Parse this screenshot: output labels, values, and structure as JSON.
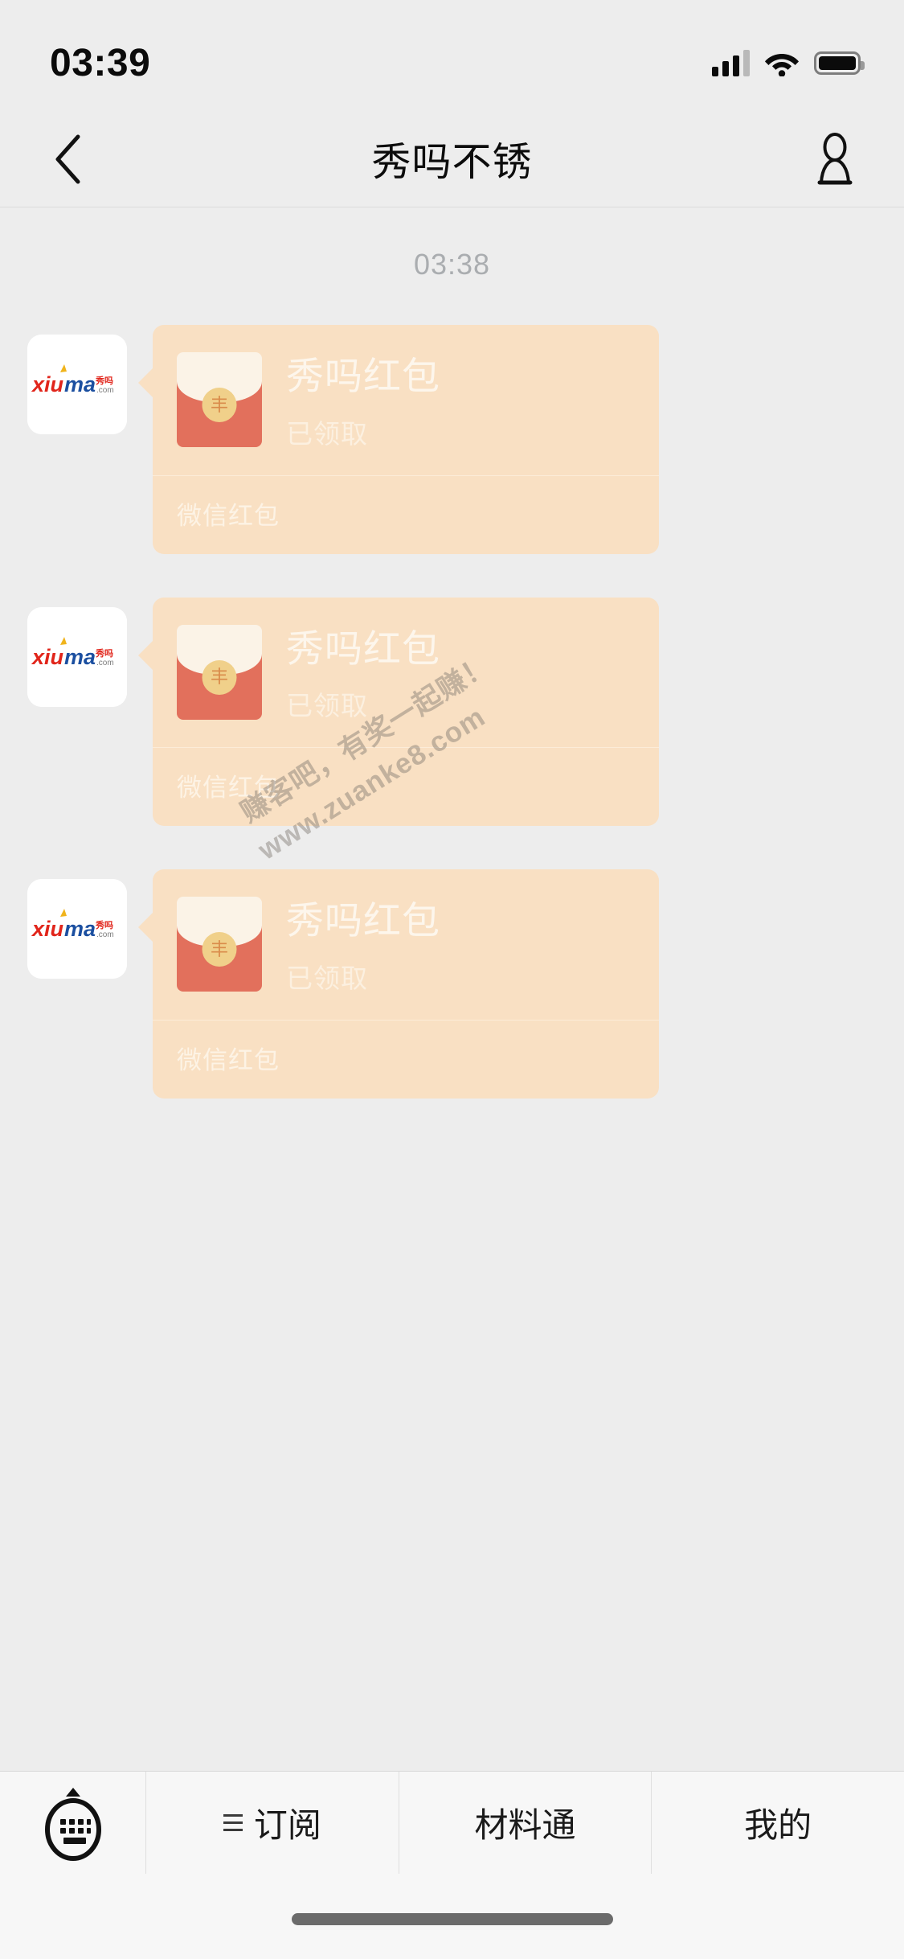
{
  "status_bar": {
    "time": "03:39",
    "signal_icon": "cellular-signal-icon",
    "wifi_icon": "wifi-icon",
    "battery_icon": "battery-icon"
  },
  "nav_bar": {
    "back_icon": "chevron-left-icon",
    "title": "秀吗不锈",
    "contact_icon": "person-icon"
  },
  "chat": {
    "timestamp": "03:38",
    "messages": [
      {
        "avatar_alt": "xiuma-logo",
        "title": "秀吗红包",
        "subtitle": "已领取",
        "footer": "微信红包",
        "envelope_seal": "丰"
      },
      {
        "avatar_alt": "xiuma-logo",
        "title": "秀吗红包",
        "subtitle": "已领取",
        "footer": "微信红包",
        "envelope_seal": "丰"
      },
      {
        "avatar_alt": "xiuma-logo",
        "title": "秀吗红包",
        "subtitle": "已领取",
        "footer": "微信红包",
        "envelope_seal": "丰"
      }
    ],
    "watermark": {
      "line1": "赚客吧，有奖一起赚！",
      "line2": "www.zuanke8.com"
    }
  },
  "toolbar": {
    "keyboard_icon": "keyboard-icon",
    "items": [
      {
        "label": "订阅",
        "icon": "list-lines-icon"
      },
      {
        "label": "材料通",
        "icon": ""
      },
      {
        "label": "我的",
        "icon": ""
      }
    ]
  },
  "logo": {
    "xiu": "xiu",
    "ma": "ma",
    "cn": "秀吗",
    "com": ".com"
  },
  "colors": {
    "page_bg": "#ededed",
    "bubble_bg": "#f9e0c3",
    "envelope_red": "#e2705c",
    "envelope_flap": "#fbf3e7",
    "seal_gold": "#f0d08a",
    "bubble_text": "#fdf6ec",
    "timestamp": "#aaadb0",
    "toolbar_bg": "#f7f7f7",
    "logo_red": "#e1251b",
    "logo_blue": "#1b4fa0"
  }
}
